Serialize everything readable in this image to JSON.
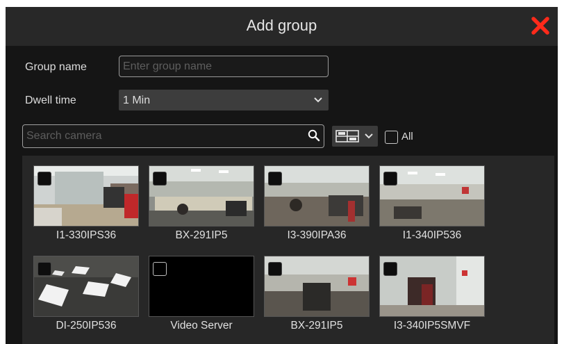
{
  "dialog": {
    "title": "Add group",
    "close_icon": "close-x-icon",
    "accent": "#ff2a1a"
  },
  "form": {
    "group_name_label": "Group name",
    "group_name_placeholder": "Enter group name",
    "group_name_value": "",
    "dwell_label": "Dwell time",
    "dwell_value": "1 Min"
  },
  "search": {
    "placeholder": "Search camera",
    "icon": "search-icon",
    "view_icon": "grid-view-icon",
    "all_label": "All",
    "all_checked": false
  },
  "cameras": [
    {
      "name": "I1-330IPS36",
      "scene": "office-room",
      "checked": false
    },
    {
      "name": "BX-291IP5",
      "scene": "office-wide",
      "checked": false
    },
    {
      "name": "I3-390IPA36",
      "scene": "office-desk",
      "checked": false
    },
    {
      "name": "I1-340IP536",
      "scene": "office-wide",
      "checked": false
    },
    {
      "name": "DI-250IP536",
      "scene": "ceiling-lights",
      "checked": false
    },
    {
      "name": "Video Server",
      "scene": "no-signal",
      "checked": false
    },
    {
      "name": "BX-291IP5",
      "scene": "office-desk",
      "checked": false
    },
    {
      "name": "I3-340IP5SMVF",
      "scene": "fisheye",
      "checked": false
    }
  ]
}
